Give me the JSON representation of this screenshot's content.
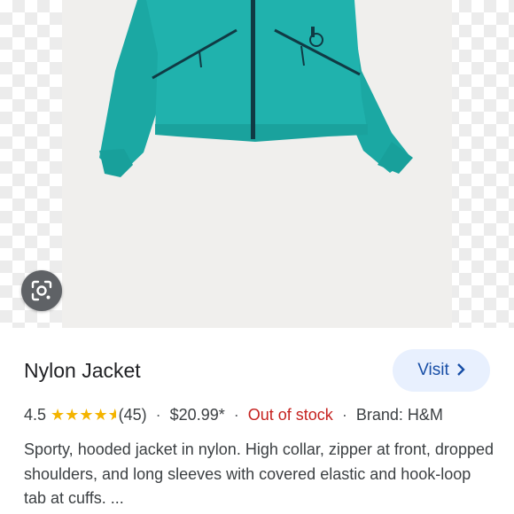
{
  "product": {
    "title": "Nylon Jacket",
    "rating": "4.5",
    "stars": "★★★★",
    "reviews": "(45)",
    "price": "$20.99*",
    "stock": "Out of stock",
    "brand": "Brand: H&M",
    "description": "Sporty, hooded jacket in nylon. High collar, zipper at front, dropped shoulders, and long sleeves with covered elastic and hook-loop tab at cuffs. ...",
    "rating_value": 4.5
  },
  "actions": {
    "visit_label": "Visit",
    "visit_icon": "chevron-right-icon",
    "lens_icon": "lens-search-icon"
  },
  "colors": {
    "jacket": "#1aa9a4",
    "accent_blue": "#174ea6",
    "out_of_stock": "#c5221f",
    "star": "#f4b400"
  }
}
